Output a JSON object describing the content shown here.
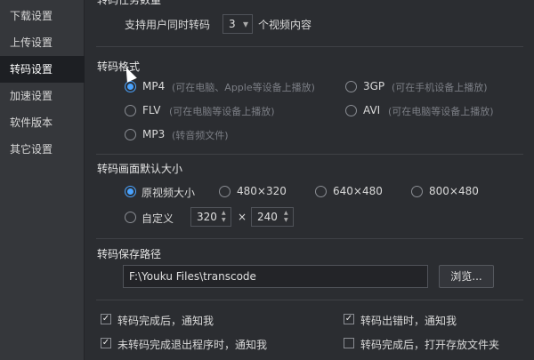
{
  "sidebar": {
    "items": [
      {
        "label": "下载设置"
      },
      {
        "label": "上传设置"
      },
      {
        "label": "转码设置"
      },
      {
        "label": "加速设置"
      },
      {
        "label": "软件版本"
      },
      {
        "label": "其它设置"
      }
    ],
    "active_index": 2
  },
  "concurrency": {
    "title": "转码任务数量",
    "prefix": "支持用户同时转码",
    "value": "3",
    "suffix": "个视频内容"
  },
  "format": {
    "title": "转码格式",
    "options": [
      {
        "label": "MP4",
        "hint": "(可在电脑、Apple等设备上播放)",
        "selected": true
      },
      {
        "label": "3GP",
        "hint": "(可在手机设备上播放)",
        "selected": false
      },
      {
        "label": "FLV",
        "hint": "(可在电脑等设备上播放)",
        "selected": false
      },
      {
        "label": "AVI",
        "hint": "(可在电脑等设备上播放)",
        "selected": false
      },
      {
        "label": "MP3",
        "hint": "(转音频文件)",
        "selected": false
      }
    ]
  },
  "size": {
    "title": "转码画面默认大小",
    "options": [
      {
        "label": "原视频大小",
        "selected": true
      },
      {
        "label": "480×320",
        "selected": false
      },
      {
        "label": "640×480",
        "selected": false
      },
      {
        "label": "800×480",
        "selected": false
      },
      {
        "label": "自定义",
        "selected": false
      }
    ],
    "custom_width": "320",
    "times": "×",
    "custom_height": "240"
  },
  "save_path": {
    "title": "转码保存路径",
    "value": "F:\\Youku Files\\transcode",
    "browse_label": "浏览..."
  },
  "notifications": [
    {
      "label": "转码完成后，通知我",
      "checked": true
    },
    {
      "label": "转码出错时，通知我",
      "checked": true
    },
    {
      "label": "未转码完成退出程序时，通知我",
      "checked": true
    },
    {
      "label": "转码完成后，打开存放文件夹",
      "checked": false
    }
  ],
  "glyphs": {
    "check": "✓",
    "dropdown": "▾",
    "up": "▲",
    "down": "▼"
  },
  "colors": {
    "accent": "#4aa3ff",
    "background": "#2b2d31",
    "sidebar": "#35373b",
    "sidebar_active": "#1d1f23"
  }
}
